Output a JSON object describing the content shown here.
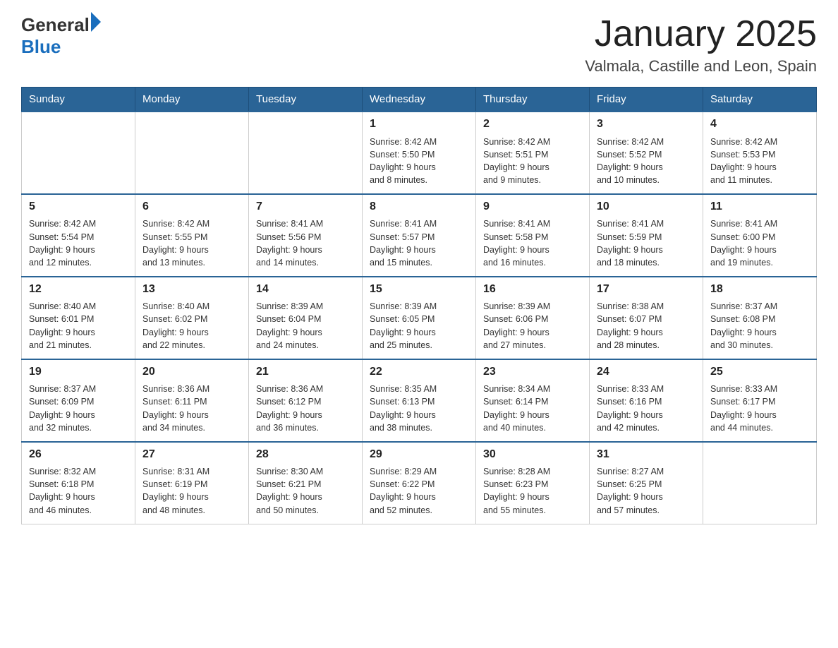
{
  "logo": {
    "general": "General",
    "triangle": "",
    "blue": "Blue"
  },
  "header": {
    "month_title": "January 2025",
    "location": "Valmala, Castille and Leon, Spain"
  },
  "weekdays": [
    "Sunday",
    "Monday",
    "Tuesday",
    "Wednesday",
    "Thursday",
    "Friday",
    "Saturday"
  ],
  "weeks": [
    [
      {
        "day": "",
        "info": ""
      },
      {
        "day": "",
        "info": ""
      },
      {
        "day": "",
        "info": ""
      },
      {
        "day": "1",
        "info": "Sunrise: 8:42 AM\nSunset: 5:50 PM\nDaylight: 9 hours\nand 8 minutes."
      },
      {
        "day": "2",
        "info": "Sunrise: 8:42 AM\nSunset: 5:51 PM\nDaylight: 9 hours\nand 9 minutes."
      },
      {
        "day": "3",
        "info": "Sunrise: 8:42 AM\nSunset: 5:52 PM\nDaylight: 9 hours\nand 10 minutes."
      },
      {
        "day": "4",
        "info": "Sunrise: 8:42 AM\nSunset: 5:53 PM\nDaylight: 9 hours\nand 11 minutes."
      }
    ],
    [
      {
        "day": "5",
        "info": "Sunrise: 8:42 AM\nSunset: 5:54 PM\nDaylight: 9 hours\nand 12 minutes."
      },
      {
        "day": "6",
        "info": "Sunrise: 8:42 AM\nSunset: 5:55 PM\nDaylight: 9 hours\nand 13 minutes."
      },
      {
        "day": "7",
        "info": "Sunrise: 8:41 AM\nSunset: 5:56 PM\nDaylight: 9 hours\nand 14 minutes."
      },
      {
        "day": "8",
        "info": "Sunrise: 8:41 AM\nSunset: 5:57 PM\nDaylight: 9 hours\nand 15 minutes."
      },
      {
        "day": "9",
        "info": "Sunrise: 8:41 AM\nSunset: 5:58 PM\nDaylight: 9 hours\nand 16 minutes."
      },
      {
        "day": "10",
        "info": "Sunrise: 8:41 AM\nSunset: 5:59 PM\nDaylight: 9 hours\nand 18 minutes."
      },
      {
        "day": "11",
        "info": "Sunrise: 8:41 AM\nSunset: 6:00 PM\nDaylight: 9 hours\nand 19 minutes."
      }
    ],
    [
      {
        "day": "12",
        "info": "Sunrise: 8:40 AM\nSunset: 6:01 PM\nDaylight: 9 hours\nand 21 minutes."
      },
      {
        "day": "13",
        "info": "Sunrise: 8:40 AM\nSunset: 6:02 PM\nDaylight: 9 hours\nand 22 minutes."
      },
      {
        "day": "14",
        "info": "Sunrise: 8:39 AM\nSunset: 6:04 PM\nDaylight: 9 hours\nand 24 minutes."
      },
      {
        "day": "15",
        "info": "Sunrise: 8:39 AM\nSunset: 6:05 PM\nDaylight: 9 hours\nand 25 minutes."
      },
      {
        "day": "16",
        "info": "Sunrise: 8:39 AM\nSunset: 6:06 PM\nDaylight: 9 hours\nand 27 minutes."
      },
      {
        "day": "17",
        "info": "Sunrise: 8:38 AM\nSunset: 6:07 PM\nDaylight: 9 hours\nand 28 minutes."
      },
      {
        "day": "18",
        "info": "Sunrise: 8:37 AM\nSunset: 6:08 PM\nDaylight: 9 hours\nand 30 minutes."
      }
    ],
    [
      {
        "day": "19",
        "info": "Sunrise: 8:37 AM\nSunset: 6:09 PM\nDaylight: 9 hours\nand 32 minutes."
      },
      {
        "day": "20",
        "info": "Sunrise: 8:36 AM\nSunset: 6:11 PM\nDaylight: 9 hours\nand 34 minutes."
      },
      {
        "day": "21",
        "info": "Sunrise: 8:36 AM\nSunset: 6:12 PM\nDaylight: 9 hours\nand 36 minutes."
      },
      {
        "day": "22",
        "info": "Sunrise: 8:35 AM\nSunset: 6:13 PM\nDaylight: 9 hours\nand 38 minutes."
      },
      {
        "day": "23",
        "info": "Sunrise: 8:34 AM\nSunset: 6:14 PM\nDaylight: 9 hours\nand 40 minutes."
      },
      {
        "day": "24",
        "info": "Sunrise: 8:33 AM\nSunset: 6:16 PM\nDaylight: 9 hours\nand 42 minutes."
      },
      {
        "day": "25",
        "info": "Sunrise: 8:33 AM\nSunset: 6:17 PM\nDaylight: 9 hours\nand 44 minutes."
      }
    ],
    [
      {
        "day": "26",
        "info": "Sunrise: 8:32 AM\nSunset: 6:18 PM\nDaylight: 9 hours\nand 46 minutes."
      },
      {
        "day": "27",
        "info": "Sunrise: 8:31 AM\nSunset: 6:19 PM\nDaylight: 9 hours\nand 48 minutes."
      },
      {
        "day": "28",
        "info": "Sunrise: 8:30 AM\nSunset: 6:21 PM\nDaylight: 9 hours\nand 50 minutes."
      },
      {
        "day": "29",
        "info": "Sunrise: 8:29 AM\nSunset: 6:22 PM\nDaylight: 9 hours\nand 52 minutes."
      },
      {
        "day": "30",
        "info": "Sunrise: 8:28 AM\nSunset: 6:23 PM\nDaylight: 9 hours\nand 55 minutes."
      },
      {
        "day": "31",
        "info": "Sunrise: 8:27 AM\nSunset: 6:25 PM\nDaylight: 9 hours\nand 57 minutes."
      },
      {
        "day": "",
        "info": ""
      }
    ]
  ]
}
